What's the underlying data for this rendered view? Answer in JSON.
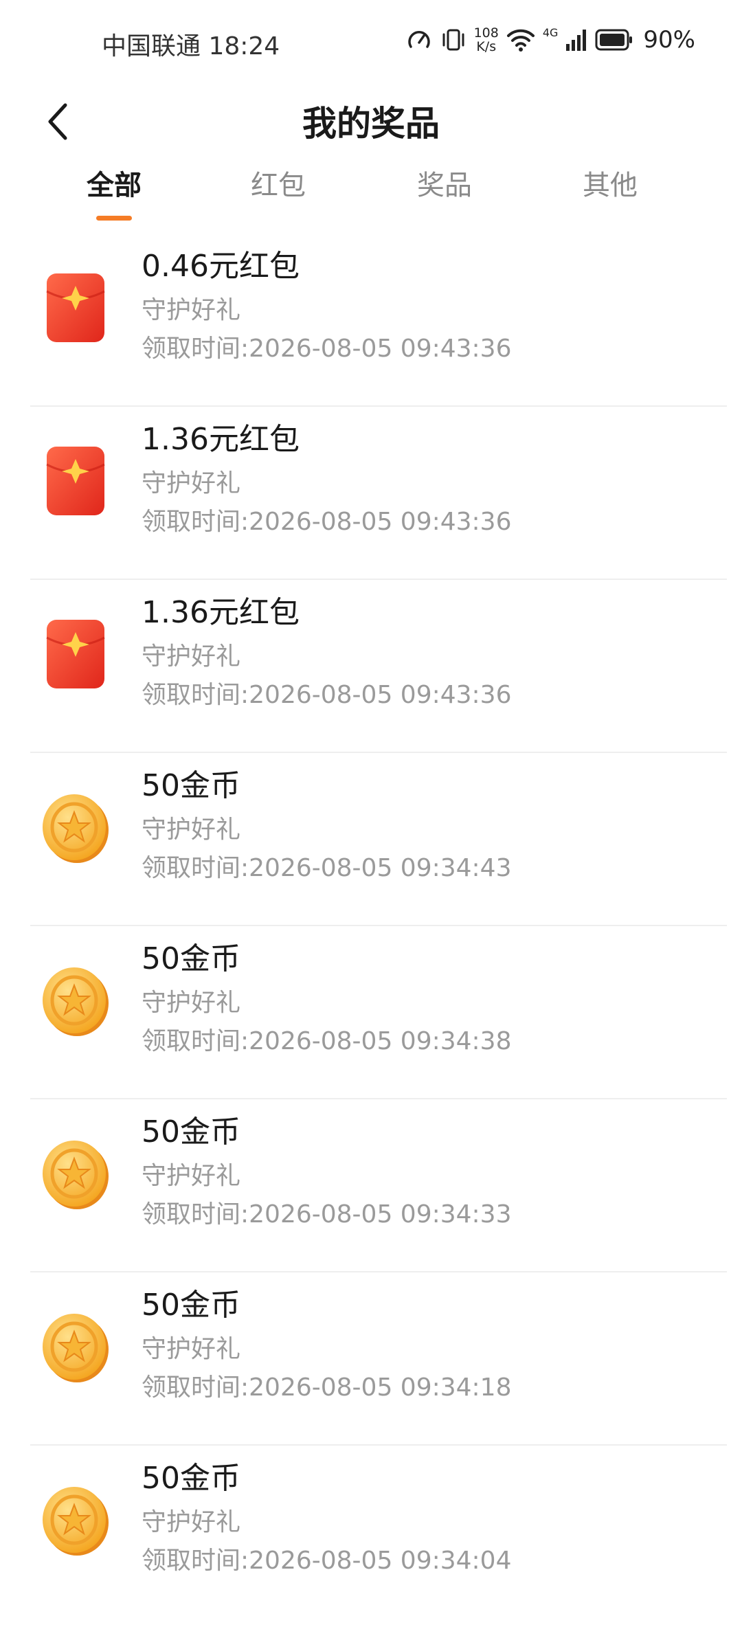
{
  "status_bar": {
    "carrier_time": "中国联通 18:24",
    "net_speed_value": "108",
    "net_speed_unit": "K/s",
    "network_type": "4G",
    "battery": "90%",
    "icons": [
      "nfc-icon",
      "vibrate-icon",
      "wifi-icon",
      "signal-icon",
      "battery-icon"
    ]
  },
  "header": {
    "back_icon": "chevron-left-icon",
    "title": "我的奖品"
  },
  "tabs": [
    {
      "label": "全部",
      "active": true
    },
    {
      "label": "红包",
      "active": false
    },
    {
      "label": "奖品",
      "active": false
    },
    {
      "label": "其他",
      "active": false
    }
  ],
  "accent_color": "#f57c26",
  "items": [
    {
      "icon": "red-envelope-icon",
      "title": "0.46元红包",
      "subtitle": "守护好礼",
      "time": "领取时间:2026-08-05 09:43:36"
    },
    {
      "icon": "red-envelope-icon",
      "title": "1.36元红包",
      "subtitle": "守护好礼",
      "time": "领取时间:2026-08-05 09:43:36"
    },
    {
      "icon": "red-envelope-icon",
      "title": "1.36元红包",
      "subtitle": "守护好礼",
      "time": "领取时间:2026-08-05 09:43:36"
    },
    {
      "icon": "gold-coin-icon",
      "title": "50金币",
      "subtitle": "守护好礼",
      "time": "领取时间:2026-08-05 09:34:43"
    },
    {
      "icon": "gold-coin-icon",
      "title": "50金币",
      "subtitle": "守护好礼",
      "time": "领取时间:2026-08-05 09:34:38"
    },
    {
      "icon": "gold-coin-icon",
      "title": "50金币",
      "subtitle": "守护好礼",
      "time": "领取时间:2026-08-05 09:34:33"
    },
    {
      "icon": "gold-coin-icon",
      "title": "50金币",
      "subtitle": "守护好礼",
      "time": "领取时间:2026-08-05 09:34:18"
    },
    {
      "icon": "gold-coin-icon",
      "title": "50金币",
      "subtitle": "守护好礼",
      "time": "领取时间:2026-08-05 09:34:04"
    }
  ]
}
